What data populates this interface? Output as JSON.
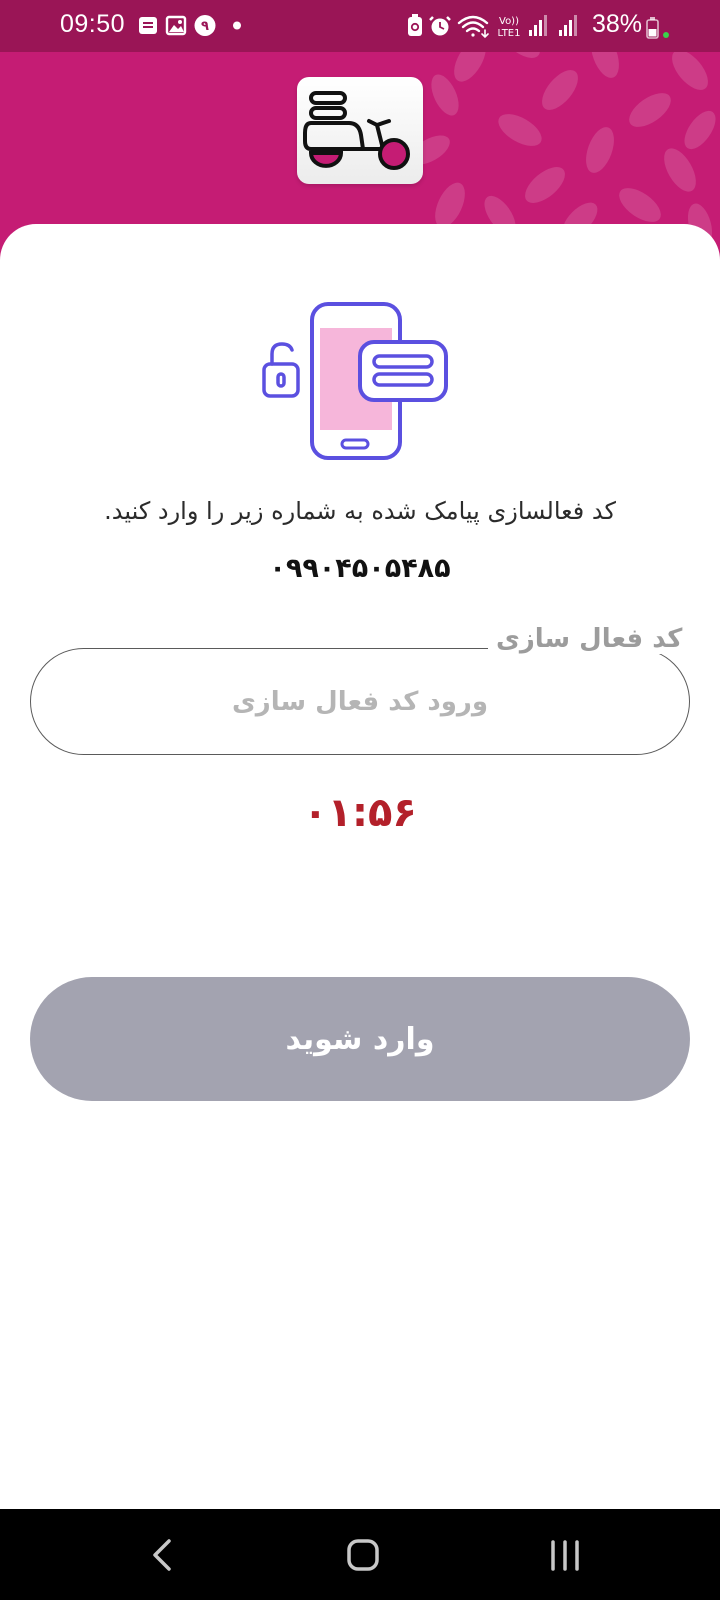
{
  "status_bar": {
    "time": "09:50",
    "left_icons": [
      "message-icon",
      "gallery-icon",
      "app-badge-icon",
      "dot-icon"
    ],
    "right_icons": [
      "battery-saver-icon",
      "alarm-icon",
      "wifi-icon",
      "volte-icon",
      "signal-icon",
      "signal-icon"
    ],
    "volte_label": "Vo))",
    "lte_label": "LTE1",
    "battery_text": "38%",
    "badge_digit": "۹"
  },
  "header": {
    "logo_icon": "delivery-scooter-icon",
    "brand_color": "#c51c74"
  },
  "verify": {
    "illustration_icon": "phone-sms-unlock-icon",
    "instruction": "کد فعالسازی پیامک شده به شماره زیر را وارد کنید.",
    "phone_number": "۰۹۹۰۴۵۰۵۴۸۵",
    "field_label": "کد فعال سازی",
    "field_placeholder": "ورود کد فعال سازی",
    "field_value": "",
    "countdown": "۰۱:۵۶",
    "countdown_color": "#b3202a",
    "submit_label": "وارد شوید",
    "submit_color": "#a3a3b0"
  },
  "nav_bar": {
    "back_icon": "back-chevron-icon",
    "home_icon": "home-icon",
    "recents_icon": "recents-icon"
  }
}
